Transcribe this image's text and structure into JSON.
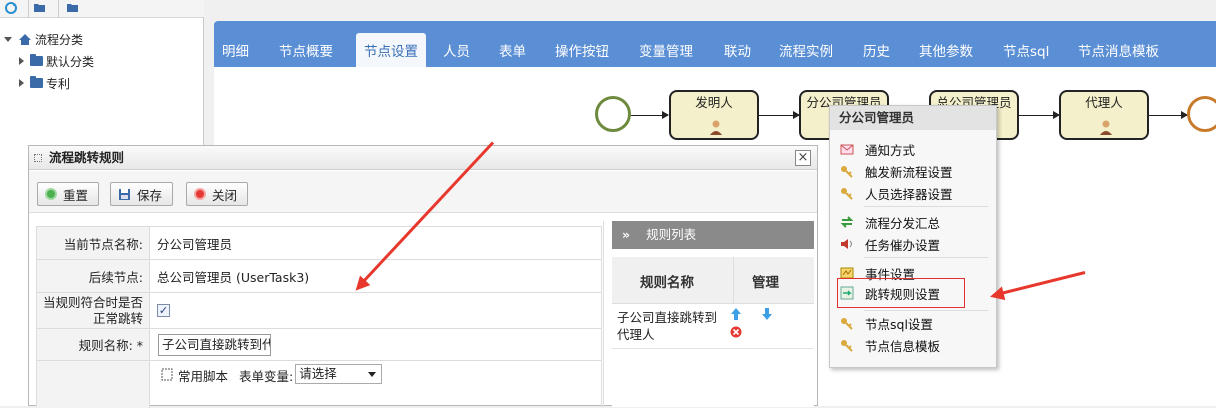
{
  "tree": {
    "root": "流程分类",
    "children": [
      "默认分类",
      "专利"
    ]
  },
  "tabs": [
    "明细",
    "节点概要",
    "节点设置",
    "人员",
    "表单",
    "操作按钮",
    "变量管理",
    "联动",
    "流程实例",
    "历史",
    "其他参数",
    "节点sql",
    "节点消息模板"
  ],
  "active_tab": "节点设置",
  "flow": {
    "nodes": [
      "发明人",
      "分公司管理员",
      "总公司管理员",
      "代理人"
    ]
  },
  "context_menu": {
    "title": "分公司管理员",
    "items": [
      "通知方式",
      "触发新流程设置",
      "人员选择器设置",
      "流程分发汇总",
      "任务催办设置",
      "事件设置",
      "跳转规则设置",
      "节点sql设置",
      "节点信息模板"
    ],
    "highlighted": "跳转规则设置"
  },
  "dialog": {
    "title": "流程跳转规则",
    "buttons": {
      "reset": "重置",
      "save": "保存",
      "close": "关闭"
    },
    "form": {
      "current_node_label": "当前节点名称:",
      "current_node_value": "分公司管理员",
      "next_node_label": "后续节点:",
      "next_node_value": "总公司管理员 (UserTask3)",
      "normal_jump_label_1": "当规则符合时是否",
      "normal_jump_label_2": "正常跳转",
      "normal_jump_checked": true,
      "rule_name_label": "规则名称: *",
      "rule_name_value": "子公司直接跳转到代",
      "script_label": "常用脚本",
      "form_var_label": "表单变量:",
      "form_var_selected": "请选择"
    },
    "rules_list": {
      "header": "规则列表",
      "col_name": "规则名称",
      "col_manage": "管理",
      "rows": [
        {
          "name_line1": "子公司直接跳转到",
          "name_line2": "代理人"
        }
      ]
    }
  },
  "colors": {
    "tabbar": "#5b8fd5",
    "node_fill": "#f4f0cc",
    "start_circle": "#6e8a3d",
    "end_circle": "#c77a2a",
    "annotation_arrow": "#e8382e"
  }
}
